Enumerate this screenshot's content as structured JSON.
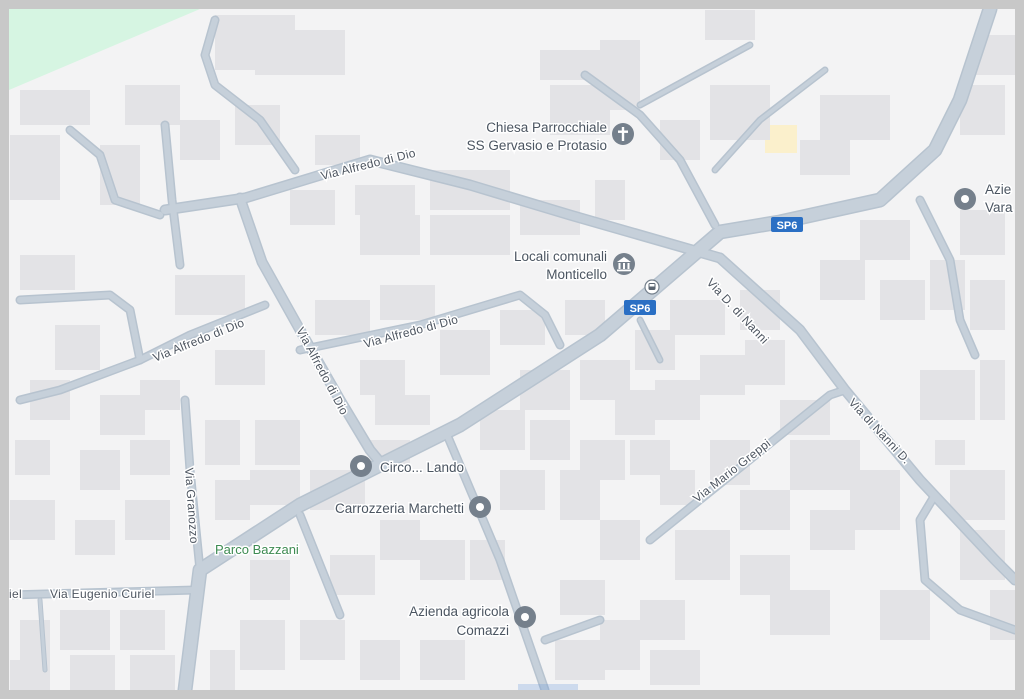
{
  "map": {
    "streets": {
      "alfredo_top": "Via Alfredo di Dio",
      "alfredo_mid": "Via Alfredo di Dio",
      "alfredo_left": "Via Alfredo di Dio",
      "alfredo_vertical": "Via Alfredo di Dio",
      "granozzo": "Via Granozzo",
      "curiel": "Via Eugenio Curiel",
      "curiel_edge": "iel",
      "greppi": "Via Mario Greppi",
      "nanni_1": "Via D. di Nanni",
      "nanni_2": "Via di Nanni D."
    },
    "route_shields": [
      "SP6",
      "SP6"
    ],
    "pois": {
      "chiesa_line1": "Chiesa Parrocchiale",
      "chiesa_line2": "SS Gervasio e Protasio",
      "locali_line1": "Locali comunali",
      "locali_line2": "Monticello",
      "circo": "Circo... Lando",
      "carrozzeria": "Carrozzeria Marchetti",
      "azienda_line1": "Azienda agricola",
      "azienda_line2": "Comazzi",
      "azie_edge_line1": "Azie",
      "azie_edge_line2": "Vara"
    },
    "park": "Parco Bazzani",
    "icons": {
      "chiesa": "church-icon",
      "locali": "civic-building-icon",
      "bus": "bus-stop-icon",
      "generic": "map-pin-icon"
    },
    "colors": {
      "background": "#f3f3f4",
      "building": "#e3e3e6",
      "road": "#c6d0da",
      "road_casing": "#b7c3cf",
      "park": "#d6f5e2",
      "shield": "#2a6fc4",
      "poi_marker": "#75808c",
      "park_text": "#3e8b52"
    }
  }
}
